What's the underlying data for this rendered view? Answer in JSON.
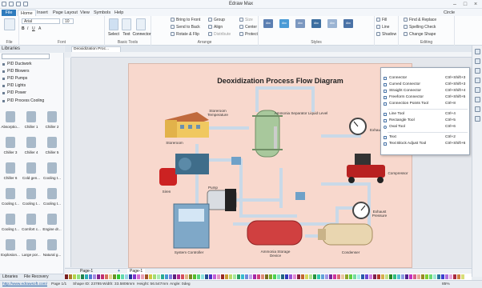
{
  "window": {
    "title": "Edraw Max"
  },
  "menubar": [
    "File",
    "Home",
    "Insert",
    "Page Layout",
    "View",
    "Symbols",
    "Help"
  ],
  "account": {
    "user": "Circle"
  },
  "ribbon": {
    "clipboard": {
      "label": "File"
    },
    "font": {
      "family": "Arial",
      "size": "10",
      "label": "Font"
    },
    "tools": {
      "select": "Select",
      "text": "Text",
      "connector": "Connector",
      "label": "Basic Tools"
    },
    "arrange": {
      "bring_front": "Bring to Front",
      "send_back": "Send to Back",
      "rotate": "Rotate & Flip",
      "group": "Group",
      "align": "Align",
      "distribute": "Distribute",
      "size": "Size",
      "center": "Center",
      "protect": "Protect",
      "label": "Arrange"
    },
    "styles": {
      "label": "Styles",
      "swatch_text": "Abc",
      "colors": [
        "#5b7fb2",
        "#4b9bd6",
        "#7c98c0",
        "#3d6fa0",
        "#9bb4d3",
        "#4a72a6"
      ]
    },
    "fill": {
      "fill": "Fill",
      "line": "Line",
      "shadow": "Shadow"
    },
    "editing": {
      "find": "Find & Replace",
      "spelling": "Spelling Check",
      "change": "Change Shape",
      "label": "Editing"
    }
  },
  "left": {
    "header": "Libraries",
    "items": [
      "PID Ductwork",
      "PID Blowers",
      "PID Pumps",
      "PID Lights",
      "PID Power",
      "PID Process Cooling"
    ],
    "shapes": [
      "Absorptio...",
      "Chiller 1",
      "Chiller 2",
      "Chiller 3",
      "Chiller 4",
      "Chiller 5",
      "Chiller 6",
      "Cold gen...",
      "Cooling t...",
      "Cooling t...",
      "Cooling t...",
      "Cooling t...",
      "Cooling t...",
      "Comfort c...",
      "Engine dr...",
      "Explosion...",
      "Large por...",
      "Natural g..."
    ],
    "tabs": [
      "Libraries",
      "File Recovery"
    ]
  },
  "doc": {
    "tab": "Deoxidization Proc..."
  },
  "diagram": {
    "title": "Deoxidization Process Flow Diagram",
    "labels": [
      "Storeroom Temperature",
      "Ammonia Separator Liquid Level",
      "Storeroom",
      "Exhaust Pressure",
      "Compressor",
      "Siren",
      "Pump",
      "Exhaust Pressure",
      "System Controller",
      "Ammonia Storage Device",
      "Condenser"
    ]
  },
  "context_menu": [
    {
      "label": "Connector",
      "shortcut": "Ctrl+Shift+3"
    },
    {
      "label": "Curved Connector",
      "shortcut": "Ctrl+Shift+3"
    },
    {
      "label": "Straight Connector",
      "shortcut": "Ctrl+Shift+4"
    },
    {
      "label": "Freeform Connector",
      "shortcut": "Ctrl+Shift+5"
    },
    {
      "label": "Connection Points Tool",
      "shortcut": "Ctrl+8"
    },
    {
      "label": "Line Tool",
      "shortcut": "Ctrl+4"
    },
    {
      "label": "Rectangle Tool",
      "shortcut": "Ctrl+5"
    },
    {
      "label": "Oval Tool",
      "shortcut": "Ctrl+6"
    },
    {
      "label": "Text",
      "shortcut": "Ctrl+2"
    },
    {
      "label": "Text Block Adjust Tool",
      "shortcut": "Ctrl+Shift+6"
    }
  ],
  "pages": {
    "prev": "Page-1",
    "current": "Page-1"
  },
  "status": {
    "url": "http://www.edrawsoft.com/",
    "page": "Page 1/1",
    "shape_id": "Shape ID: 23785",
    "width": "Width: 33.5806mm",
    "height": "Height: 56.547mm",
    "angle": "Angle: 0deg",
    "zoom": "85%"
  }
}
